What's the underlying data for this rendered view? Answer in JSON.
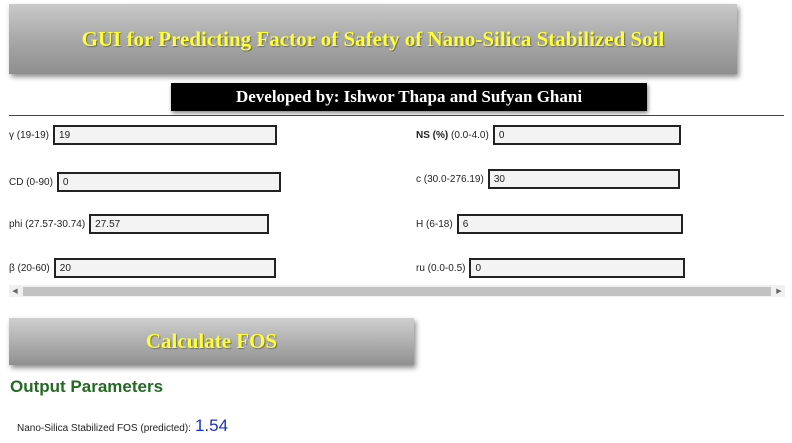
{
  "header": {
    "title": "GUI for Predicting Factor of Safety of Nano-Silica Stabilized Soil",
    "developer": "Developed by: Ishwor Thapa and Sufyan Ghani"
  },
  "inputs": {
    "gamma": {
      "label": "γ (19-19)",
      "value": "19"
    },
    "cd": {
      "label": "CD (0-90)",
      "value": "0"
    },
    "phi": {
      "label": "phi (27.57-30.74)",
      "value": "27.57"
    },
    "beta": {
      "label": "β (20-60)",
      "value": "20"
    },
    "ns": {
      "label_bold": "NS (%)",
      "label_range": "(0.0-4.0)",
      "value": "0"
    },
    "c": {
      "label": "c (30.0-276.19)",
      "value": "30"
    },
    "h": {
      "label": "H (6-18)",
      "value": "6"
    },
    "ru": {
      "label": "ru (0.0-0.5)",
      "value": "0"
    }
  },
  "actions": {
    "calculate_label": "Calculate FOS"
  },
  "output": {
    "heading": "Output Parameters",
    "fos_label": "Nano-Silica Stabilized FOS (predicted):",
    "fos_value": "1.54"
  },
  "colors": {
    "title_text": "#ffff33",
    "heading_green": "#236b23",
    "value_blue": "#1a2fc4"
  },
  "icons": {
    "scroll_left": "triangle-left",
    "scroll_right": "triangle-right"
  }
}
